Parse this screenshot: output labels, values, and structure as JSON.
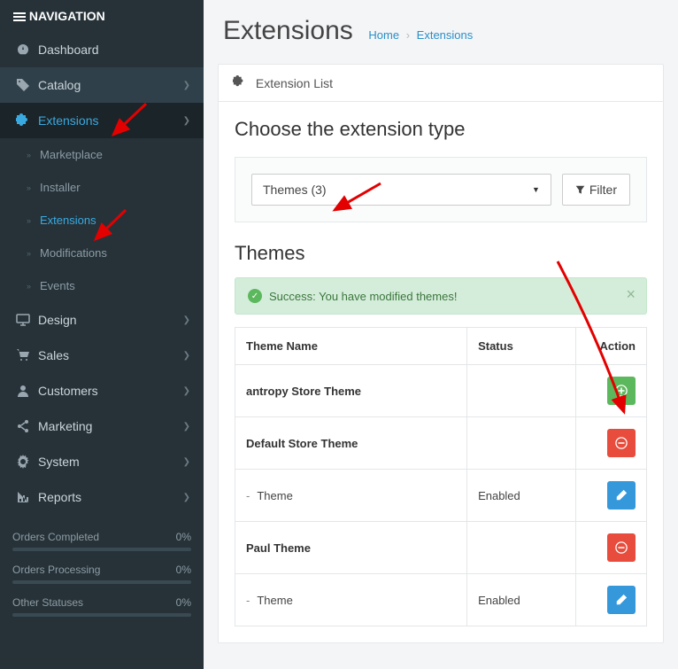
{
  "sidebar": {
    "header": "NAVIGATION",
    "items": [
      {
        "label": "Dashboard"
      },
      {
        "label": "Catalog"
      },
      {
        "label": "Extensions"
      },
      {
        "label": "Design"
      },
      {
        "label": "Sales"
      },
      {
        "label": "Customers"
      },
      {
        "label": "Marketing"
      },
      {
        "label": "System"
      },
      {
        "label": "Reports"
      }
    ],
    "subitems": [
      {
        "label": "Marketplace"
      },
      {
        "label": "Installer"
      },
      {
        "label": "Extensions"
      },
      {
        "label": "Modifications"
      },
      {
        "label": "Events"
      }
    ],
    "stats": [
      {
        "label": "Orders Completed",
        "value": "0%"
      },
      {
        "label": "Orders Processing",
        "value": "0%"
      },
      {
        "label": "Other Statuses",
        "value": "0%"
      }
    ]
  },
  "header": {
    "title": "Extensions",
    "breadcrumb_home": "Home",
    "breadcrumb_current": "Extensions"
  },
  "panel": {
    "heading": "Extension List",
    "choose_title": "Choose the extension type",
    "select_value": "Themes (3)",
    "filter_label": "Filter",
    "section_title": "Themes",
    "alert": "Success: You have modified themes!",
    "table": {
      "col_name": "Theme Name",
      "col_status": "Status",
      "col_action": "Action",
      "rows": [
        {
          "name": "antropy Store Theme",
          "status": "",
          "btn": "add",
          "bold": true,
          "indent": false
        },
        {
          "name": "Default Store Theme",
          "status": "",
          "btn": "remove",
          "bold": true,
          "indent": false
        },
        {
          "name": "Theme",
          "status": "Enabled",
          "btn": "edit",
          "bold": false,
          "indent": true
        },
        {
          "name": "Paul Theme",
          "status": "",
          "btn": "remove",
          "bold": true,
          "indent": false
        },
        {
          "name": "Theme",
          "status": "Enabled",
          "btn": "edit",
          "bold": false,
          "indent": true
        }
      ]
    }
  }
}
